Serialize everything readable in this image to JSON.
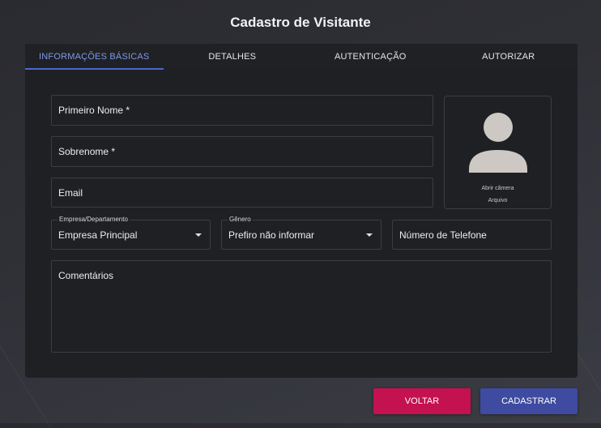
{
  "page": {
    "title": "Cadastro de Visitante"
  },
  "tabs": [
    {
      "label": "INFORMAÇÕES BÁSICAS",
      "active": true
    },
    {
      "label": "DETALHES",
      "active": false
    },
    {
      "label": "AUTENTICAÇÃO",
      "active": false
    },
    {
      "label": "AUTORIZAR",
      "active": false
    }
  ],
  "form": {
    "first_name_label": "Primeiro Nome *",
    "last_name_label": "Sobrenome *",
    "email_label": "Email",
    "company": {
      "label": "Empresa/Departamento",
      "value": "Empresa Principal"
    },
    "gender": {
      "label": "Gênero",
      "value": "Prefiro não informar"
    },
    "phone_label": "Número de Telefone",
    "comments_label": "Comentários"
  },
  "photo": {
    "icon": "user-silhouette-icon",
    "open_camera": "Abrir câmera",
    "file": "Arquivo"
  },
  "buttons": {
    "back": "VOLTAR",
    "submit": "CADASTRAR"
  },
  "colors": {
    "accent_tab": "#7e98e6",
    "back_button": "#c4114f",
    "submit_button": "#3e4ba0"
  }
}
